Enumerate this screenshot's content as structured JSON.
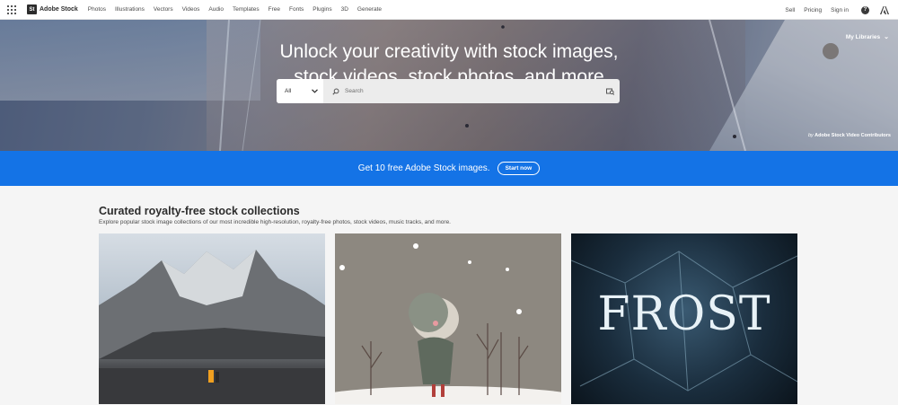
{
  "nav": {
    "brand": "Adobe Stock",
    "brand_mark": "St",
    "links": [
      "Photos",
      "Illustrations",
      "Vectors",
      "Videos",
      "Audio",
      "Templates",
      "Free",
      "Fonts",
      "Plugins",
      "3D",
      "Generate"
    ],
    "right_links": [
      "Sell",
      "Pricing",
      "Sign in"
    ],
    "help_glyph": "?"
  },
  "hero": {
    "headline_line1": "Unlock your creativity with stock images,",
    "headline_line2": "stock videos, stock photos, and more",
    "my_libraries": "My Libraries",
    "credit_prefix": "by",
    "credit": "Adobe Stock Video Contributors"
  },
  "search": {
    "category": "All",
    "placeholder": "Search"
  },
  "banner": {
    "text": "Get 10 free Adobe Stock images.",
    "button": "Start now",
    "color": "#1473e6"
  },
  "collections": {
    "title": "Curated royalty-free stock collections",
    "subtitle": "Explore popular stock image collections of our most incredible high-resolution, royalty-free photos, stock videos, music tracks, and more.",
    "cards": [
      {
        "name": "mountain-photo"
      },
      {
        "name": "winter-illustration"
      },
      {
        "name": "frost-typography",
        "text": "FROST"
      }
    ]
  }
}
